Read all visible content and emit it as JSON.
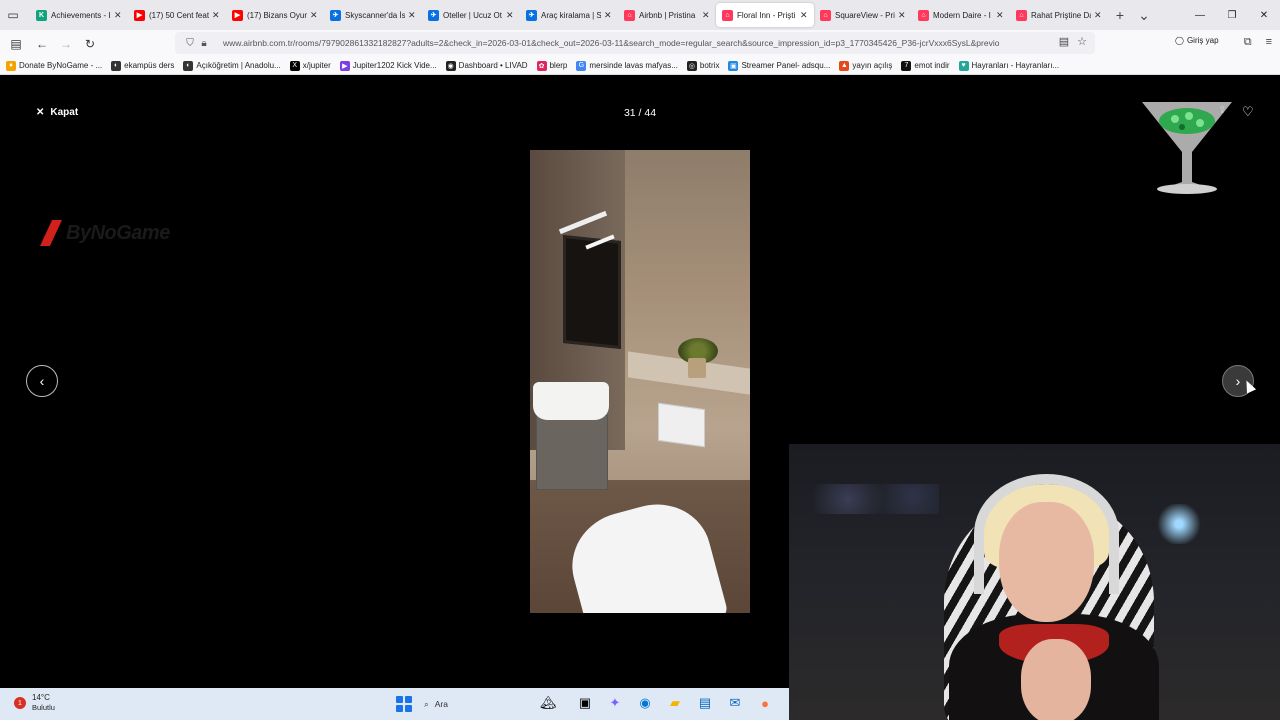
{
  "browser": {
    "tabs": [
      {
        "title": "Achievements - I",
        "fav_color": "#10a37f",
        "fav_glyph": "K",
        "active": false
      },
      {
        "title": "(17) 50 Cent feat",
        "fav_color": "#ff0000",
        "fav_glyph": "▶",
        "active": false
      },
      {
        "title": "(17) Bizans Oyun",
        "fav_color": "#ff0000",
        "fav_glyph": "▶",
        "active": false
      },
      {
        "title": "Skyscanner'da İst",
        "fav_color": "#0770e3",
        "fav_glyph": "✈",
        "active": false
      },
      {
        "title": "Oteller | Ucuz Ot",
        "fav_color": "#0770e3",
        "fav_glyph": "✈",
        "active": false
      },
      {
        "title": "Araç kiralama | S",
        "fav_color": "#0770e3",
        "fav_glyph": "✈",
        "active": false
      },
      {
        "title": "Airbnb | Pristina",
        "fav_color": "#ff385c",
        "fav_glyph": "⌂",
        "active": false
      },
      {
        "title": "Floral Inn - Prişti",
        "fav_color": "#ff385c",
        "fav_glyph": "⌂",
        "active": true
      },
      {
        "title": "SquareView - Pri",
        "fav_color": "#ff385c",
        "fav_glyph": "⌂",
        "active": false
      },
      {
        "title": "Modern Daire - I",
        "fav_color": "#ff385c",
        "fav_glyph": "⌂",
        "active": false
      },
      {
        "title": "Rahat Priştine Da",
        "fav_color": "#ff385c",
        "fav_glyph": "⌂",
        "active": false
      }
    ],
    "url": "www.airbnb.com.tr/rooms/797902861332182827?adults=2&check_in=2026-03-01&check_out=2026-03-11&search_mode=regular_search&source_impression_id=p3_1770345426_P36-jcrVxxx6SysL&previo",
    "login_label": "Giriş yap",
    "bookmarks": [
      {
        "label": "Donate ByNoGame - ...",
        "color": "#f4a300",
        "glyph": "♦"
      },
      {
        "label": "ekampüs ders",
        "color": "#333333",
        "glyph": "◐"
      },
      {
        "label": "Açıköğretim | Anadolu...",
        "color": "#333333",
        "glyph": "◐"
      },
      {
        "label": "x/jupiter",
        "color": "#000000",
        "glyph": "X"
      },
      {
        "label": "Jupiter1202 Kick Vide...",
        "color": "#7b3fe4",
        "glyph": "▶"
      },
      {
        "label": "Dashboard • LIVAD",
        "color": "#222222",
        "glyph": "◉"
      },
      {
        "label": "blerp",
        "color": "#e0245e",
        "glyph": "✿"
      },
      {
        "label": "mersinde lavas mafyas...",
        "color": "#4285f4",
        "glyph": "G"
      },
      {
        "label": "botrix",
        "color": "#222222",
        "glyph": "◎"
      },
      {
        "label": "Streamer Panel- adsqu...",
        "color": "#1e88e5",
        "glyph": "▣"
      },
      {
        "label": "yayın açılış",
        "color": "#e64a19",
        "glyph": "▲"
      },
      {
        "label": "emot indir",
        "color": "#111111",
        "glyph": "7"
      },
      {
        "label": "Hayranları - Hayranları...",
        "color": "#26a69a",
        "glyph": "♥"
      }
    ]
  },
  "viewer": {
    "close_label": "Kapat",
    "counter": "31 / 44",
    "prev_icon": "‹",
    "next_icon": "›"
  },
  "overlay": {
    "logo_text": "ByNoGame",
    "logo_color": "#d2201c"
  },
  "taskbar": {
    "weather_temp": "14°C",
    "weather_condition": "Bulutlu",
    "weather_badge": "1",
    "search_label": "Ara"
  }
}
